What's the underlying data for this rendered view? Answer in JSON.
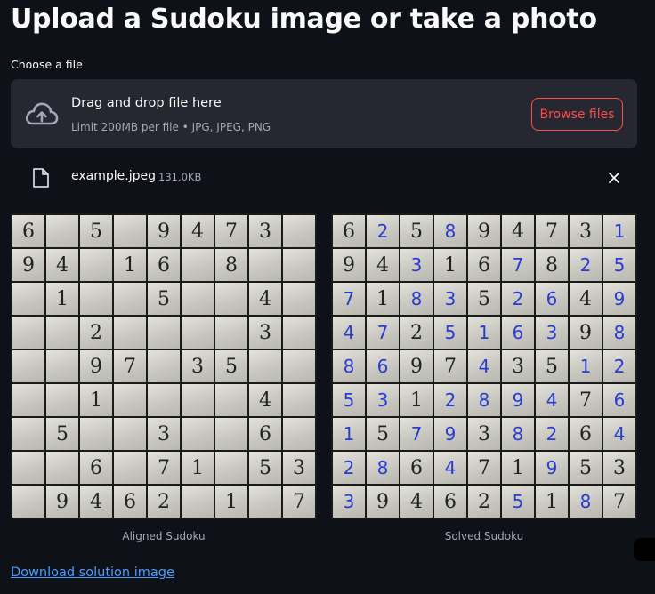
{
  "page": {
    "title": "Upload a Sudoku image or take a photo",
    "choose_label": "Choose a file"
  },
  "uploader": {
    "title": "Drag and drop file here",
    "limits": "Limit 200MB per file • JPG, JPEG, PNG",
    "browse_label": "Browse files",
    "icon": "cloud-upload-icon"
  },
  "file": {
    "name": "example.jpeg",
    "size": "131.0KB",
    "icon": "file-icon"
  },
  "aligned": {
    "caption": "Aligned Sudoku",
    "grid": [
      "6 5 9473 ",
      "94 16 8  ",
      " 1  5  4 ",
      "  2    3 ",
      "  97 35  ",
      "  1    4 ",
      " 5  3  6 ",
      "  6 71 53",
      " 9462 1 7"
    ]
  },
  "solved": {
    "caption": "Solved Sudoku",
    "grid": [
      "625894731",
      "943167825",
      "718352649",
      "472516398",
      "869743512",
      "531289476",
      "157938264",
      "286471953",
      "394625187"
    ]
  },
  "download_label": "Download solution image",
  "colors": {
    "background": "#0e1117",
    "panel": "#262730",
    "accent": "#ff4b4b",
    "link": "#4a9eff",
    "solved_digit": "#2a3bd4"
  }
}
